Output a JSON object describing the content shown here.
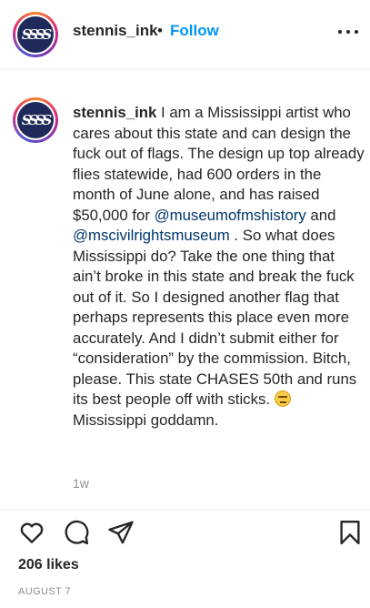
{
  "header": {
    "username": "stennis_ink",
    "separator": "•",
    "follow_label": "Follow",
    "avatar_letters": "SSSS"
  },
  "caption": {
    "username": "stennis_ink",
    "text_1": " I am a Mississippi artist who cares about this state and can design the fuck out of flags. The design up top already flies statewide, had 600 orders in the month of June alone, and has raised $50,000 for ",
    "mention_1": "@museumofmshistory",
    "text_2": " and ",
    "mention_2": "@mscivilrightsmuseum",
    "text_3": " . So what does Mississippi do? Take the one thing that ain’t broke in this state and break the fuck out of it. So I designed another flag that perhaps represents this place even more accurately. And I didn’t submit either for “consideration” by the commission. Bitch, please. This state CHASES 50th and runs its best people off with sticks. ",
    "text_4": " Mississippi goddamn.",
    "emoji_icon": "expressionless-face-emoji",
    "time_ago": "1w"
  },
  "actions": {
    "icons": [
      "heart-icon",
      "comment-icon",
      "share-icon",
      "bookmark-icon"
    ]
  },
  "footer": {
    "likes": "206 likes",
    "date": "AUGUST 7"
  },
  "colors": {
    "follow": "#0095f6",
    "mention": "#00376b",
    "secondary_text": "#8e8e8e",
    "avatar_bg": "#1f2a5a"
  }
}
